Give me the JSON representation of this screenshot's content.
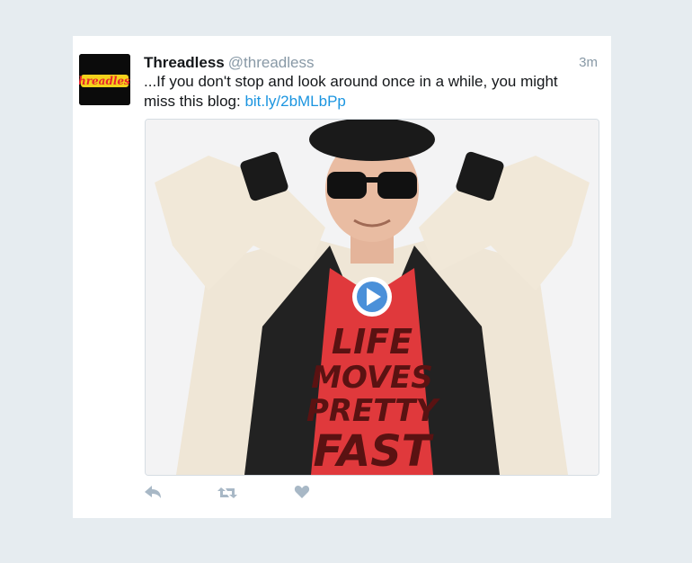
{
  "tweet": {
    "display_name": "Threadless",
    "handle": "@threadless",
    "time": "3m",
    "text": "...If you don't stop and look around once in a while, you might miss this blog: ",
    "link": "bit.ly/2bMLbPp"
  },
  "avatar": {
    "logo_text": "threadless",
    "logo_color": "#e8262c",
    "logo_outline": "#f4d21c"
  },
  "media": {
    "shirt_lines": [
      "LIFE",
      "MOVES",
      "PRETTY",
      "FAST"
    ],
    "shirt_color": "#e0393c",
    "play_color": "#4a90d9"
  },
  "actions": {
    "icon_color": "#a8b8c6",
    "reply_icon": "reply-icon",
    "retweet_icon": "retweet-icon",
    "like_icon": "heart-icon"
  }
}
